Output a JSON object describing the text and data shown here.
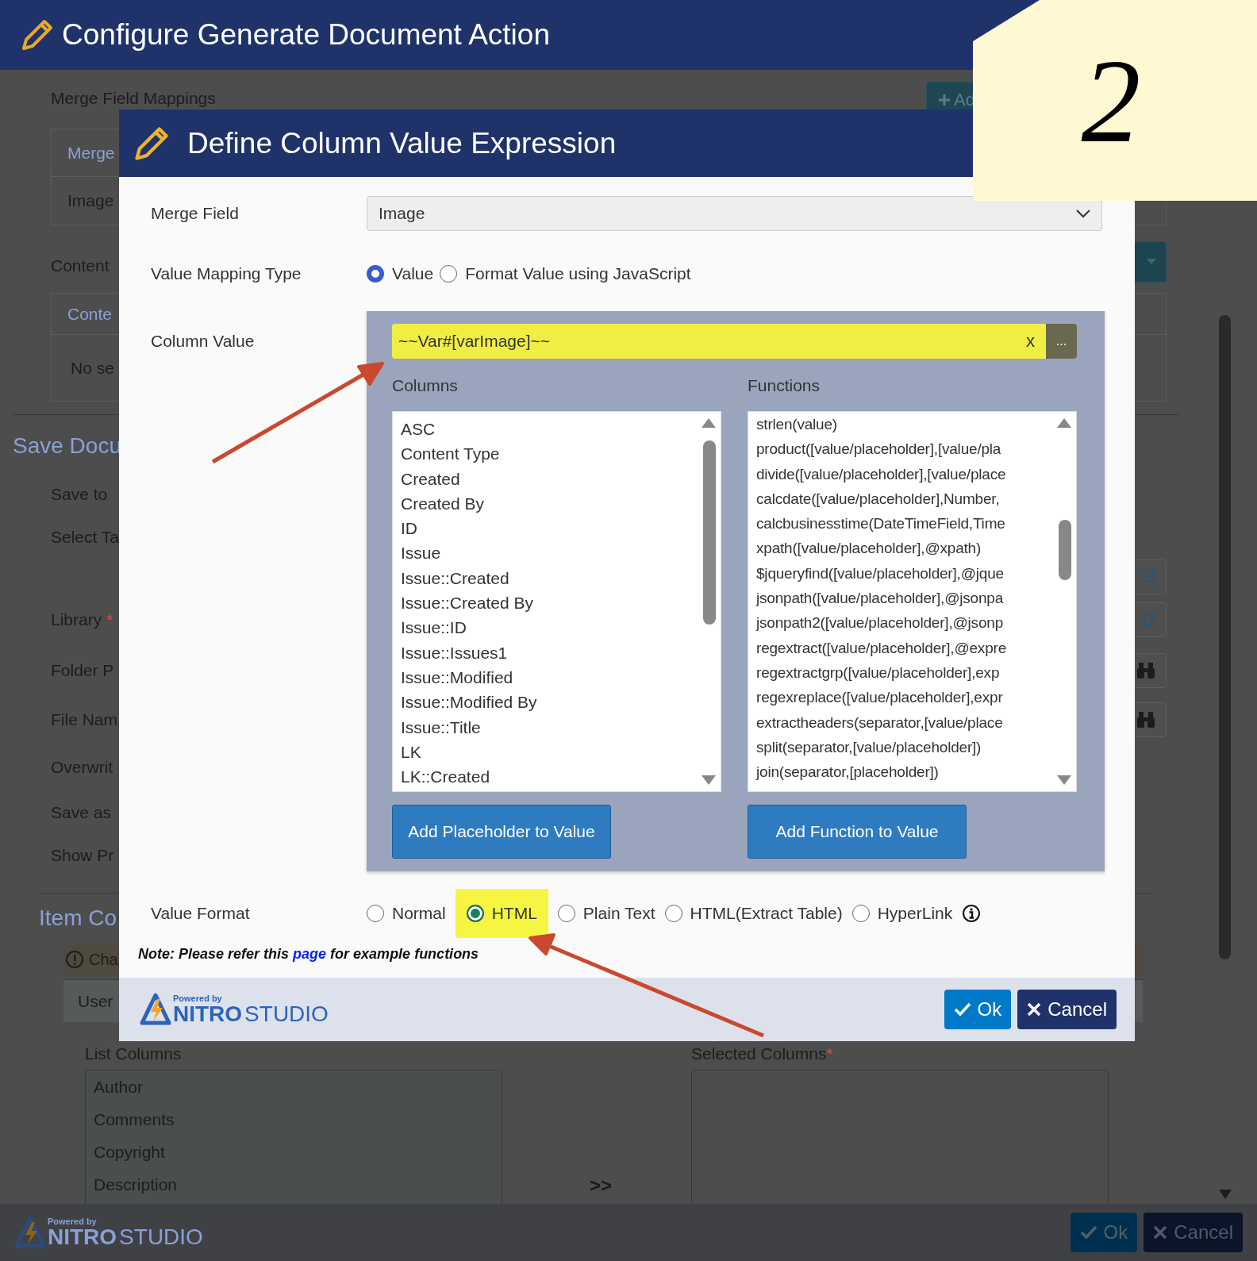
{
  "background": {
    "title": "Configure Generate Document Action",
    "add_button": "Ad",
    "mappings_label": "Merge Field Mappings",
    "mappings_table": [
      {
        "text": "Merge",
        "kind": "header"
      },
      {
        "text": "Image",
        "kind": "cell"
      }
    ],
    "content_label": "Content",
    "content_table": [
      {
        "text": "Conte",
        "kind": "header"
      },
      {
        "text": "No se",
        "kind": "cell"
      }
    ],
    "section_heading": "Save Docu",
    "required_mark": "*",
    "fields": [
      {
        "label": "Save to",
        "required": false
      },
      {
        "label": "Select Ta",
        "required": false,
        "kind": "link"
      },
      {
        "label": "Library",
        "required": true,
        "kind": "link"
      },
      {
        "label": "Folder P",
        "required": false,
        "kind": "binoculars"
      },
      {
        "label": "File Nam",
        "required": false,
        "kind": "binoculars"
      },
      {
        "label": "Overwrit",
        "required": false
      },
      {
        "label": "Save as",
        "required": false
      },
      {
        "label": "Show Pr",
        "required": false
      }
    ],
    "item_heading": "Item Co",
    "warning": "Cha",
    "tab": "User",
    "list_label": "List Columns",
    "list_items": [
      "Author",
      "Comments",
      "Copyright",
      "Description"
    ],
    "move_button": ">>",
    "selected_label": "Selected Columns",
    "selected_required": true,
    "logo": {
      "powered": "Powered by",
      "brand": "NITRO",
      "product": "STUDIO"
    },
    "ok": "Ok",
    "cancel": "Cancel"
  },
  "dialog": {
    "title": "Define Column Value Expression",
    "merge_field": {
      "label": "Merge Field",
      "value": "Image"
    },
    "mapping_type": {
      "label": "Value Mapping Type",
      "options": [
        {
          "label": "Value",
          "selected": true
        },
        {
          "label": "Format Value using JavaScript",
          "selected": false
        }
      ]
    },
    "column_value": {
      "label": "Column Value",
      "value": "~~Var#[varImage]~~",
      "highlighted": true,
      "clear": "x",
      "more": "...",
      "columns_label": "Columns",
      "columns": [
        "ASC",
        "Content Type",
        "Created",
        "Created By",
        "ID",
        "Issue",
        "Issue::Created",
        "Issue::Created By",
        "Issue::ID",
        "Issue::Issues1",
        "Issue::Modified",
        "Issue::Modified By",
        "Issue::Title",
        "LK",
        "LK::Created"
      ],
      "functions_label": "Functions",
      "functions": [
        "strlen(value)",
        "product([value/placeholder],[value/pla",
        "divide([value/placeholder],[value/place",
        "calcdate([value/placeholder],Number,",
        "calcbusinesstime(DateTimeField,Time",
        "xpath([value/placeholder],@xpath)",
        "$jqueryfind([value/placeholder],@jque",
        "jsonpath([value/placeholder],@jsonpa",
        "jsonpath2([value/placeholder],@jsonp",
        "regextract([value/placeholder],@expre",
        "regextractgrp([value/placeholder],exp",
        "regexreplace([value/placeholder],expr",
        "extractheaders(separator,[value/place",
        "split(separator,[value/placeholder])",
        "join(separator,[placeholder])"
      ],
      "add_placeholder": "Add Placeholder to Value",
      "add_function": "Add Function to Value"
    },
    "value_format": {
      "label": "Value Format",
      "options": [
        {
          "label": "Normal",
          "selected": false,
          "highlighted": false
        },
        {
          "label": "HTML",
          "selected": true,
          "highlighted": true
        },
        {
          "label": "Plain Text",
          "selected": false,
          "highlighted": false
        },
        {
          "label": "HTML(Extract Table)",
          "selected": false,
          "highlighted": false
        },
        {
          "label": "HyperLink",
          "selected": false,
          "highlighted": false
        }
      ]
    },
    "note": {
      "before": "Note: Please refer this",
      "link": "page",
      "after": "for example functions"
    },
    "logo": {
      "powered": "Powered by",
      "brand": "NITRO",
      "product": "STUDIO"
    },
    "ok": "Ok",
    "cancel": "Cancel"
  },
  "sticky_note": {
    "text": "2"
  }
}
